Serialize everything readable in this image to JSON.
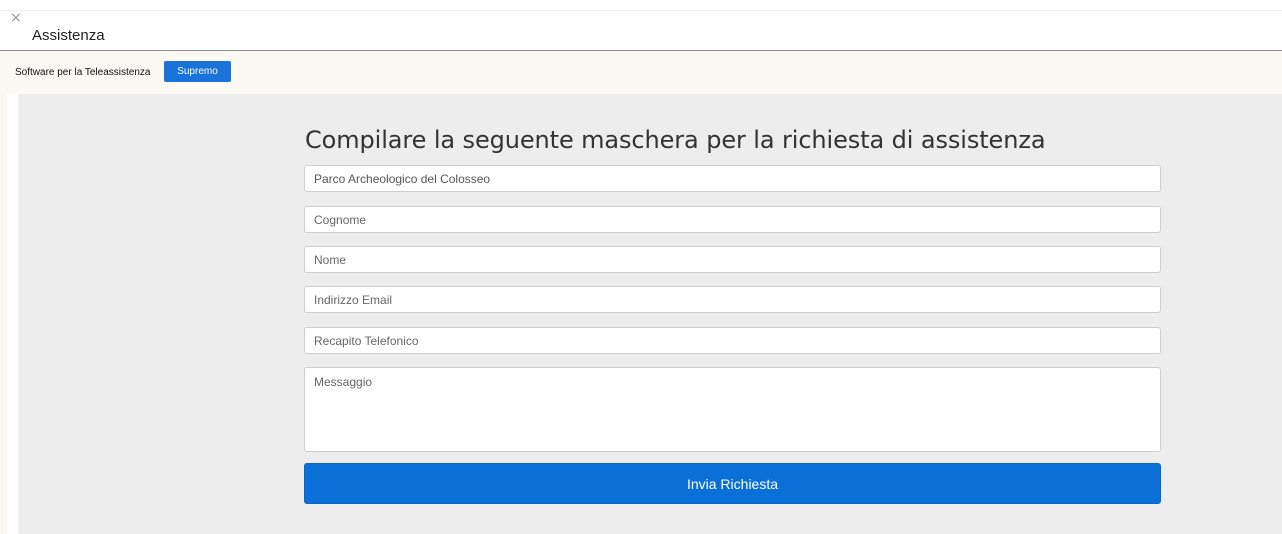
{
  "dialog": {
    "close_symbol": "×",
    "title": "Assistenza"
  },
  "toolbar": {
    "label": "Software per la Teleassistenza",
    "supremo_label": "Supremo"
  },
  "form": {
    "title": "Compilare la seguente maschera per la richiesta di assistenza",
    "fields": {
      "organization": {
        "value": "Parco Archeologico del Colosseo",
        "placeholder": ""
      },
      "surname": {
        "value": "",
        "placeholder": "Cognome"
      },
      "name": {
        "value": "",
        "placeholder": "Nome"
      },
      "email": {
        "value": "",
        "placeholder": "Indirizzo Email"
      },
      "phone": {
        "value": "",
        "placeholder": "Recapito Telefonico"
      },
      "message": {
        "value": "",
        "placeholder": "Messaggio"
      }
    },
    "submit_label": "Invia Richiesta"
  },
  "colors": {
    "accent": "#0a6fd6",
    "toolbar_bg": "#fbf9f4",
    "panel_bg": "#ededed"
  }
}
